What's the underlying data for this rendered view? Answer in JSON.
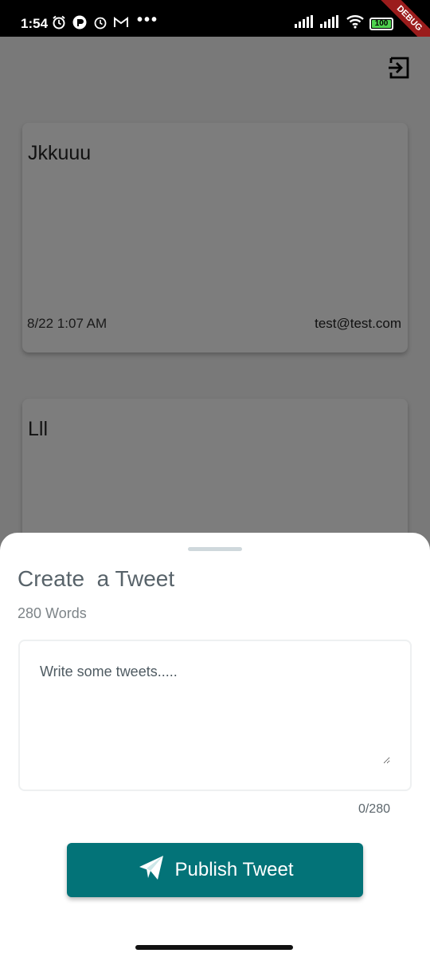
{
  "status_bar": {
    "time": "1:54",
    "battery": "100",
    "debug_label": "DEBUG",
    "more_dots": "•••",
    "battery_level": 1.0,
    "battery_color": "#4fd34f"
  },
  "feed": {
    "tweets": [
      {
        "text": "Jkkuuu",
        "time": "8/22 1:07 AM",
        "email": "test@test.com"
      },
      {
        "text": "Lll"
      }
    ]
  },
  "icons": {
    "logout": "logout-icon",
    "send": "send-icon"
  },
  "compose": {
    "title": "Create  a Tweet",
    "subtitle": "280 Words",
    "placeholder": "Write some tweets.....",
    "value": "",
    "counter": "0/280",
    "publish_label": "Publish Tweet",
    "accent_color": "#037378"
  }
}
